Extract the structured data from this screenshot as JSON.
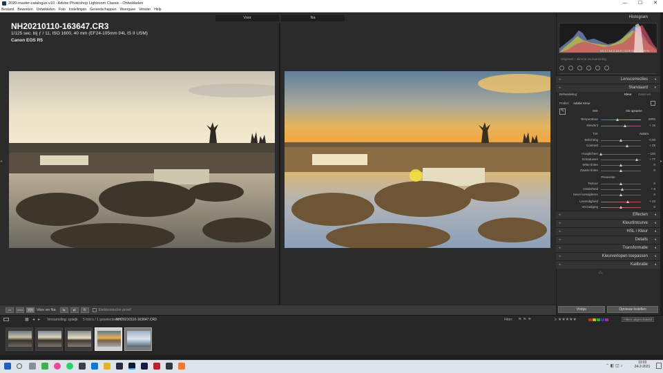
{
  "window": {
    "title": "2020-master-catalogus-v10 - Adobe Photoshop Lightroom Classic - Ontwikkelen",
    "min": "—",
    "max": "☐",
    "close": "✕"
  },
  "menu": [
    "Bestand",
    "Bewerken",
    "Ontwikkelen",
    "Foto",
    "Instellingen",
    "Gereedschappen",
    "Weergave",
    "Venster",
    "Help"
  ],
  "compare": {
    "before_label": "Voor",
    "after_label": "Na"
  },
  "info": {
    "filename": "NH20210110-163647.CR3",
    "exif": "1/125 sec. bij ƒ / 11, ISO 1600, 40 mm (EF24-105mm f/4L IS II USM)",
    "camera": "Canon EOS R5"
  },
  "toolbar": {
    "view_label": "Y|Y",
    "mode_label": "Voor en Na",
    "proof_label": "Elektronische proef"
  },
  "right_panel": {
    "histogram_title": "Histogram",
    "histogram_values": "14.1 / 14.2   14.4 / 14.9   11.2 / 21.9 %",
    "original_photo": "Origineel + slimme voorvertoning",
    "lens_corrections": "Lenscorrecties",
    "basic": "Standaard",
    "treatment_label": "Behandeling:",
    "treatment_color": "Kleur",
    "treatment_bw": "Zwart-wit",
    "profile_label": "Profiel:",
    "profile_value": "Adobe Kleur",
    "wb_label": "WB:",
    "wb_value": "Als opname",
    "temp_label": "Temperatuur",
    "temp_value": "5000",
    "tint_label": "Kleurtint",
    "tint_value": "+ 18",
    "tone_label": "Tint",
    "auto_label": "Autom.",
    "exposure_label": "Belichting",
    "exposure_value": "0,00",
    "contrast_label": "Contrast",
    "contrast_value": "+ 29",
    "highlights_label": "Hooglichten",
    "highlights_value": "− 100",
    "shadows_label": "Schaduwen",
    "shadows_value": "+ 77",
    "whites_label": "Witte tinten",
    "whites_value": "0",
    "blacks_label": "Zwarte tinten",
    "blacks_value": "0",
    "presence_label": "Presentie",
    "texture_label": "Textuur",
    "texture_value": "0",
    "clarity_label": "Helderheid",
    "clarity_value": "+ 8",
    "dehaze_label": "Nevel verwijderen",
    "dehaze_value": "0",
    "vibrance_label": "Levendigheid",
    "vibrance_value": "+ 33",
    "saturation_label": "Verzadiging",
    "saturation_value": "0",
    "effects": "Effecten",
    "tone_curve": "Kleurtintcurve",
    "hsl": "HSL / Kleur",
    "detail": "Details",
    "transform": "Transformatie",
    "split_toning": "Kleurverlopen toepassen",
    "calibration": "Kalibratie",
    "prev_button": "Vorige",
    "reset_button": "Opnieuw instellen"
  },
  "filmstrip_bar": {
    "source": "Verzameling: splatjk",
    "count": "5 foto's / 1 geselecteerd /",
    "current": "NH20210110-163647.CR3",
    "filter_label": "Filter:",
    "filter_value": "Filters uitgeschakeld"
  },
  "clock": {
    "time": "13:03",
    "date": "24-2-2021"
  },
  "colors": {
    "accent": "#e8e8e8",
    "panel": "#2a2a2a",
    "taskbar": "#dfe3ea"
  }
}
